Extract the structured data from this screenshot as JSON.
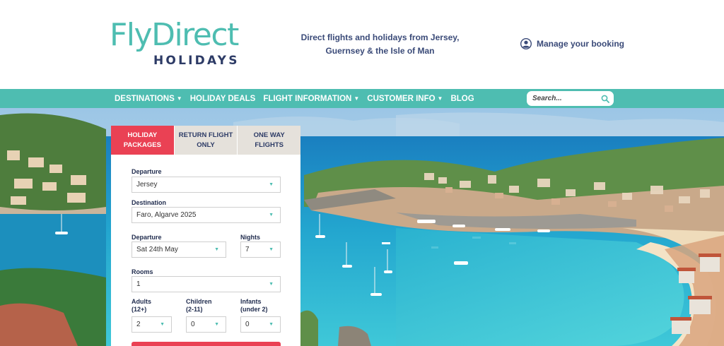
{
  "brand": {
    "line1": "FlyDirect",
    "line2": "HOLIDAYS"
  },
  "header": {
    "tagline_line1": "Direct flights and holidays from Jersey,",
    "tagline_line2": "Guernsey & the Isle of Man",
    "manage_label": "Manage your booking"
  },
  "nav": {
    "items": [
      {
        "label": "DESTINATIONS",
        "dropdown": true
      },
      {
        "label": "HOLIDAY DEALS",
        "dropdown": false
      },
      {
        "label": "FLIGHT INFORMATION",
        "dropdown": true
      },
      {
        "label": "CUSTOMER INFO",
        "dropdown": true
      },
      {
        "label": "BLOG",
        "dropdown": false
      }
    ],
    "search_placeholder": "Search..."
  },
  "widget": {
    "tabs": [
      {
        "line1": "HOLIDAY",
        "line2": "PACKAGES",
        "active": true
      },
      {
        "line1": "RETURN FLIGHT",
        "line2": "ONLY",
        "active": false
      },
      {
        "line1": "ONE WAY",
        "line2": "FLIGHTS",
        "active": false
      }
    ],
    "departure_label": "Departure",
    "departure_value": "Jersey",
    "destination_label": "Destination",
    "destination_value": "Faro, Algarve 2025",
    "date_label": "Departure",
    "date_value": "Sat 24th May",
    "nights_label": "Nights",
    "nights_value": "7",
    "rooms_label": "Rooms",
    "rooms_value": "1",
    "adults_label_1": "Adults",
    "adults_label_2": "(12+)",
    "adults_value": "2",
    "children_label_1": "Children",
    "children_label_2": "(2-11)",
    "children_value": "0",
    "infants_label_1": "Infants",
    "infants_label_2": "(under 2)",
    "infants_value": "0"
  },
  "colors": {
    "teal": "#4ebdb1",
    "navy": "#2d3b66",
    "coral": "#ea4154",
    "tab_grey": "#e5e1db"
  }
}
